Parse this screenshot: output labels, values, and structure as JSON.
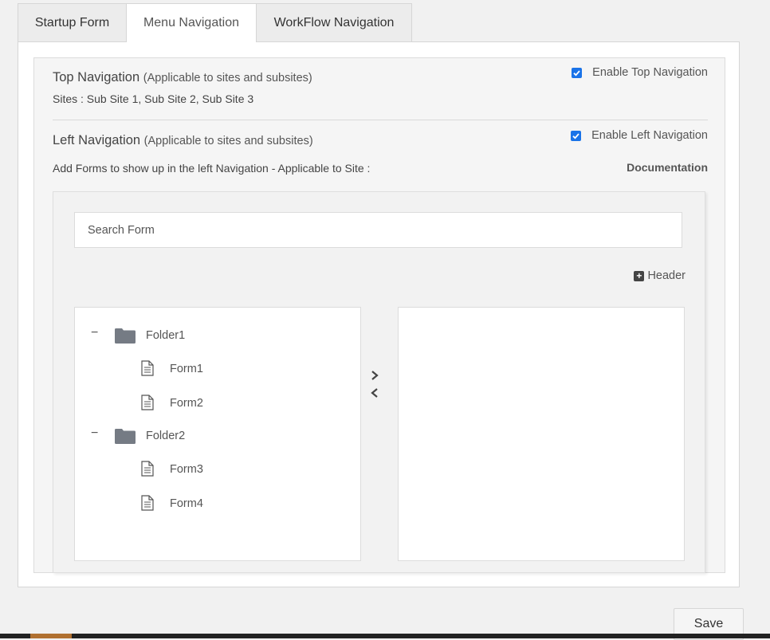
{
  "tabs": [
    {
      "label": "Startup Form",
      "active": false
    },
    {
      "label": "Menu Navigation",
      "active": true
    },
    {
      "label": "WorkFlow Navigation",
      "active": false
    }
  ],
  "top_nav": {
    "title": "Top Navigation",
    "subtitle": "(Applicable to sites and subsites)",
    "sites_line": "Sites : Sub Site 1, Sub Site 2, Sub Site 3",
    "checkbox_label": "Enable Top Navigation",
    "checked": true
  },
  "left_nav": {
    "title": "Left Navigation",
    "subtitle": "(Applicable to sites and subsites)",
    "description": "Add Forms to show up in the left Navigation - Applicable to Site :",
    "site_name": "Documentation",
    "checkbox_label": "Enable Left Navigation",
    "checked": true
  },
  "search": {
    "placeholder": "Search Form",
    "value": ""
  },
  "header_button": {
    "label": "Header",
    "icon": "plus-square-icon"
  },
  "tree": [
    {
      "folder": "Folder1",
      "expanded": true,
      "collapse_symbol": "−",
      "forms": [
        "Form1",
        "Form2"
      ]
    },
    {
      "folder": "Folder2",
      "expanded": true,
      "collapse_symbol": "−",
      "forms": [
        "Form3",
        "Form4"
      ]
    }
  ],
  "selected_items": [],
  "save_button": {
    "label": "Save"
  },
  "colors": {
    "checkbox": "#1a73e8",
    "folder": "#757b84",
    "accent": "#b07030"
  }
}
